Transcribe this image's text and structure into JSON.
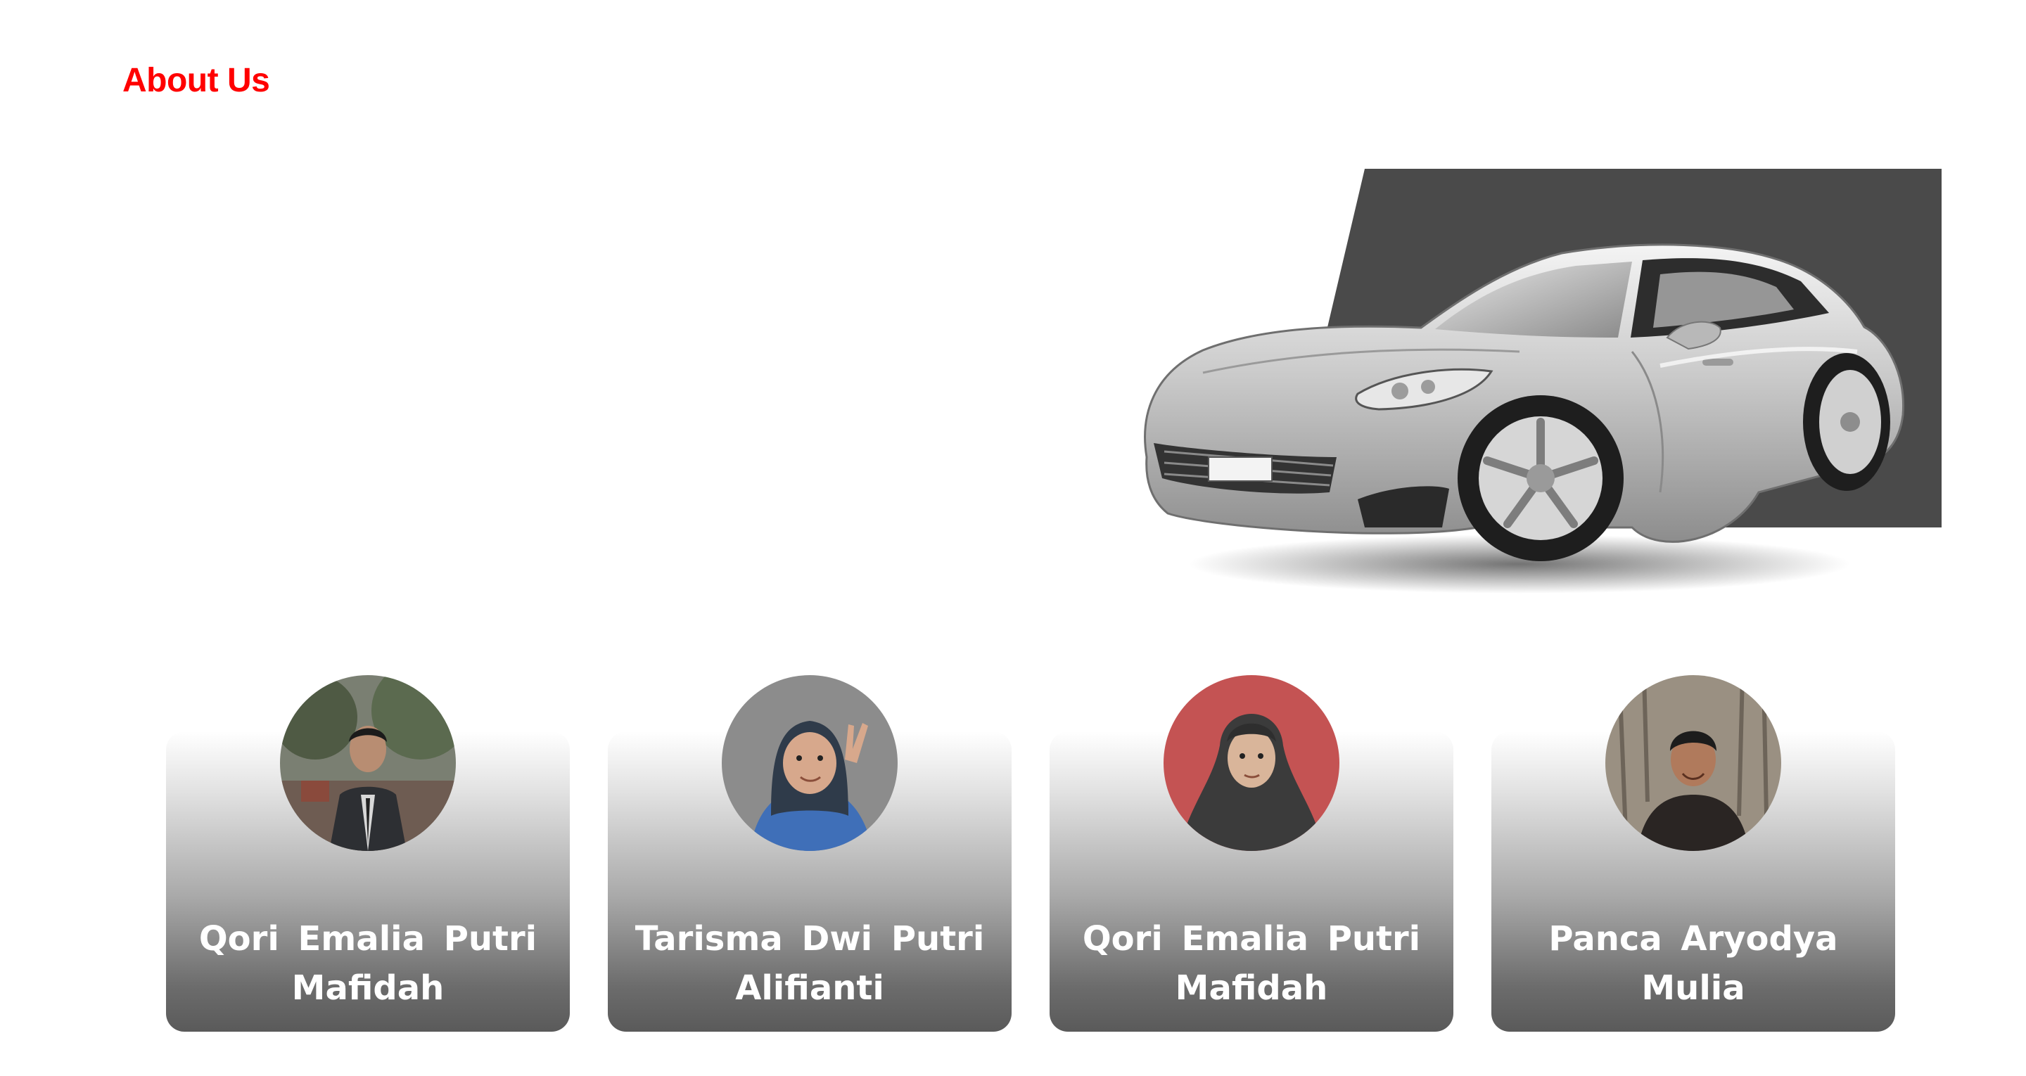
{
  "header": {
    "title": "About Us"
  },
  "colors": {
    "accent": "#ff0000",
    "hero_backdrop": "#4a4a4a",
    "card_text": "#ffffff"
  },
  "hero": {
    "image": "silver-sports-car"
  },
  "team": {
    "members": [
      {
        "name": "Qori Emalia Putri Mafidah",
        "photo": "man-in-suit-photo"
      },
      {
        "name": "Tarisma Dwi Putri Alifianti",
        "photo": "girl-in-hijab-photo"
      },
      {
        "name": "Qori Emalia Putri Mafidah",
        "photo": "woman-in-hijab-photo"
      },
      {
        "name": "Panca Aryodya Mulia",
        "photo": "young-man-photo"
      }
    ]
  }
}
